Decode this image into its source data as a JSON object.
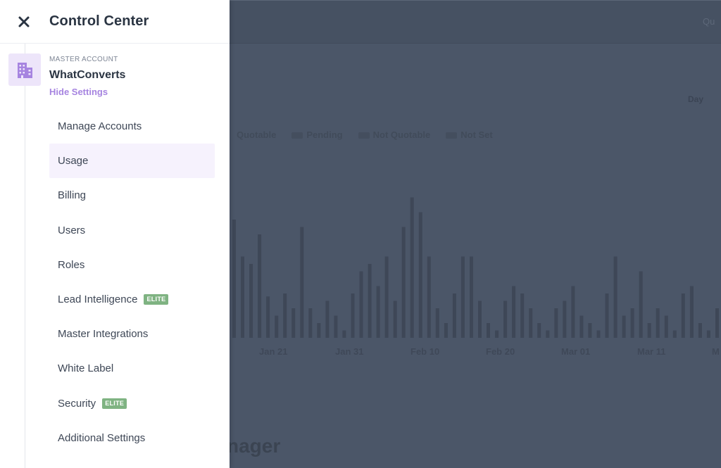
{
  "drawer": {
    "title": "Control Center",
    "account": {
      "label": "MASTER ACCOUNT",
      "name": "WhatConverts",
      "hide_settings": "Hide Settings"
    },
    "menu": [
      {
        "label": "Manage Accounts"
      },
      {
        "label": "Usage",
        "active": true
      },
      {
        "label": "Billing"
      },
      {
        "label": "Users"
      },
      {
        "label": "Roles"
      },
      {
        "label": "Lead Intelligence",
        "badge": "ELITE"
      },
      {
        "label": "Master Integrations"
      },
      {
        "label": "White Label"
      },
      {
        "label": "Security",
        "badge": "ELITE"
      },
      {
        "label": "Additional Settings"
      }
    ]
  },
  "background": {
    "topbar_right": "Qu",
    "day": "Day",
    "legend": [
      "Quotable",
      "Pending",
      "Not Quotable",
      "Not Set"
    ],
    "x_ticks": [
      "Jan 21",
      "Jan 31",
      "Feb 10",
      "Feb 20",
      "Mar 01",
      "Mar 11",
      "M"
    ],
    "heading": "nager"
  },
  "colors": {
    "accent": "#a684e0",
    "badge": "#7fb382",
    "overlay": "#4b5668"
  }
}
